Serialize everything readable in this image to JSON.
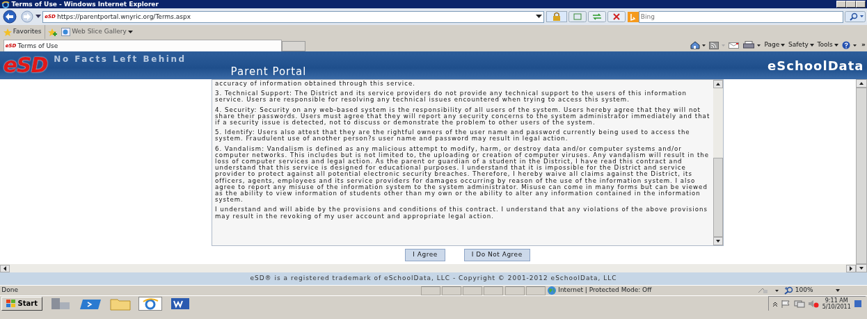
{
  "window": {
    "title": "Terms of Use - Windows Internet Explorer"
  },
  "address_bar": {
    "site_icon": "eSD",
    "url": "https://parentportal.wnyric.org/Terms.aspx"
  },
  "search": {
    "placeholder": "Bing"
  },
  "favorites_bar": {
    "favorites": "Favorites",
    "items": [
      "Web Slice Gallery"
    ]
  },
  "tabs": [
    {
      "icon": "eSD",
      "label": "Terms of Use",
      "selected": true
    }
  ],
  "command_bar": {
    "items": [
      "Page",
      "Safety",
      "Tools"
    ],
    "overflow": "»"
  },
  "banner": {
    "logo": "eSD",
    "tagline": "No Facts Left Behind",
    "portal": "Parent Portal",
    "brand": "eSchoolData"
  },
  "terms": {
    "paragraphs": [
      "accuracy of information obtained through this service.",
      "3. Technical Support: The District and its service providers do not provide any technical support to the users of this information service.  Users are responsible for resolving any technical issues encountered when trying to access this system.",
      "4. Security: Security on any web-based system is the responsibility of all users of the system.  Users hereby agree that they will not share their passwords. Users must agree that they will report any security concerns to the system administrator immediately and that if a security issue is detected, not to discuss or demonstrate the problem to other users of the system.",
      "5. Identify: Users also attest that they are the rightful owners of the user name and password currently being used to access the system. Fraudulent use of another person?s user name and password may result in legal action.",
      "6. Vandalism: Vandalism is defined as any malicious attempt to modify, harm, or destroy data and/or computer systems and/or computer networks. This includes but is not limited to, the uploading or creation of computer viruses. Any vandalism will result in the loss of computer services and legal action. As the parent or guardian of a student in the District, I have read this contract and understand that this service is designed for educational purposes. I understand that it is impossible for the District and service provider to protect against all potential electronic security breaches. Therefore, I hereby waive all claims against the District, its officers, agents, employees and its service providers for damages occurring by reason of the use of the information system.  I also agree to report any misuse of the information system to the system administrator.  Misuse can come in many forms but can be viewed as the ability to view information of students other than my own or the ability to alter any information contained in the information system.",
      "I understand and will abide by the provisions and conditions of this contract. I understand that any violations of the above provisions may result in the revoking of my user account and appropriate legal action."
    ]
  },
  "buttons": [
    "I Agree",
    "I Do Not Agree"
  ],
  "footer": "eSD® is a registered trademark of eSchoolData, LLC - Copyright © 2001-2012 eSchoolData, LLC",
  "status_bar": {
    "status": "Done",
    "zone": "Internet | Protected Mode: Off",
    "zoom": "100%"
  },
  "taskbar": {
    "start": "Start",
    "clock_time": "9:11 AM",
    "clock_date": "5/10/2011"
  }
}
